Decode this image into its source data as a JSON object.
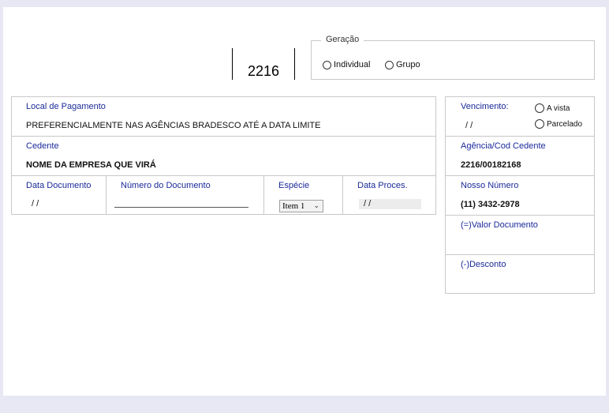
{
  "header": {
    "bank_code": "2216",
    "geracao": {
      "legend": "Geração",
      "options": [
        {
          "label": "Individual",
          "selected": false
        },
        {
          "label": "Grupo",
          "selected": false
        }
      ]
    }
  },
  "left": {
    "local_pagamento": {
      "label": "Local de Pagamento",
      "value": "PREFERENCIALMENTE NAS AGÊNCIAS BRADESCO ATÉ A DATA LIMITE"
    },
    "cedente": {
      "label": "Cedente",
      "value": "NOME DA EMPRESA QUE VIRÁ"
    },
    "data_documento": {
      "label": "Data Documento",
      "value": "/ /"
    },
    "numero_documento": {
      "label": "Número do Documento",
      "value": ""
    },
    "especie": {
      "label": "Espécie",
      "selected": "Item 1"
    },
    "data_proces": {
      "label": "Data Proces.",
      "value": "/ /"
    }
  },
  "right": {
    "vencimento": {
      "label": "Vencimento:",
      "value": "/ /",
      "options": [
        {
          "label": "A vista",
          "selected": false
        },
        {
          "label": "Parcelado",
          "selected": false
        }
      ]
    },
    "agencia": {
      "label": "Agência/Cod Cedente",
      "value": "2216/00182168"
    },
    "nosso_numero": {
      "label": "Nosso Número",
      "value": "(11) 3432-2978"
    },
    "valor_documento": {
      "label": "(=)Valor Documento"
    },
    "desconto": {
      "label": "(-)Desconto"
    }
  },
  "colors": {
    "label": "#1a2a9a",
    "border": "#c8c8c8",
    "background": "#e8e8f4"
  }
}
